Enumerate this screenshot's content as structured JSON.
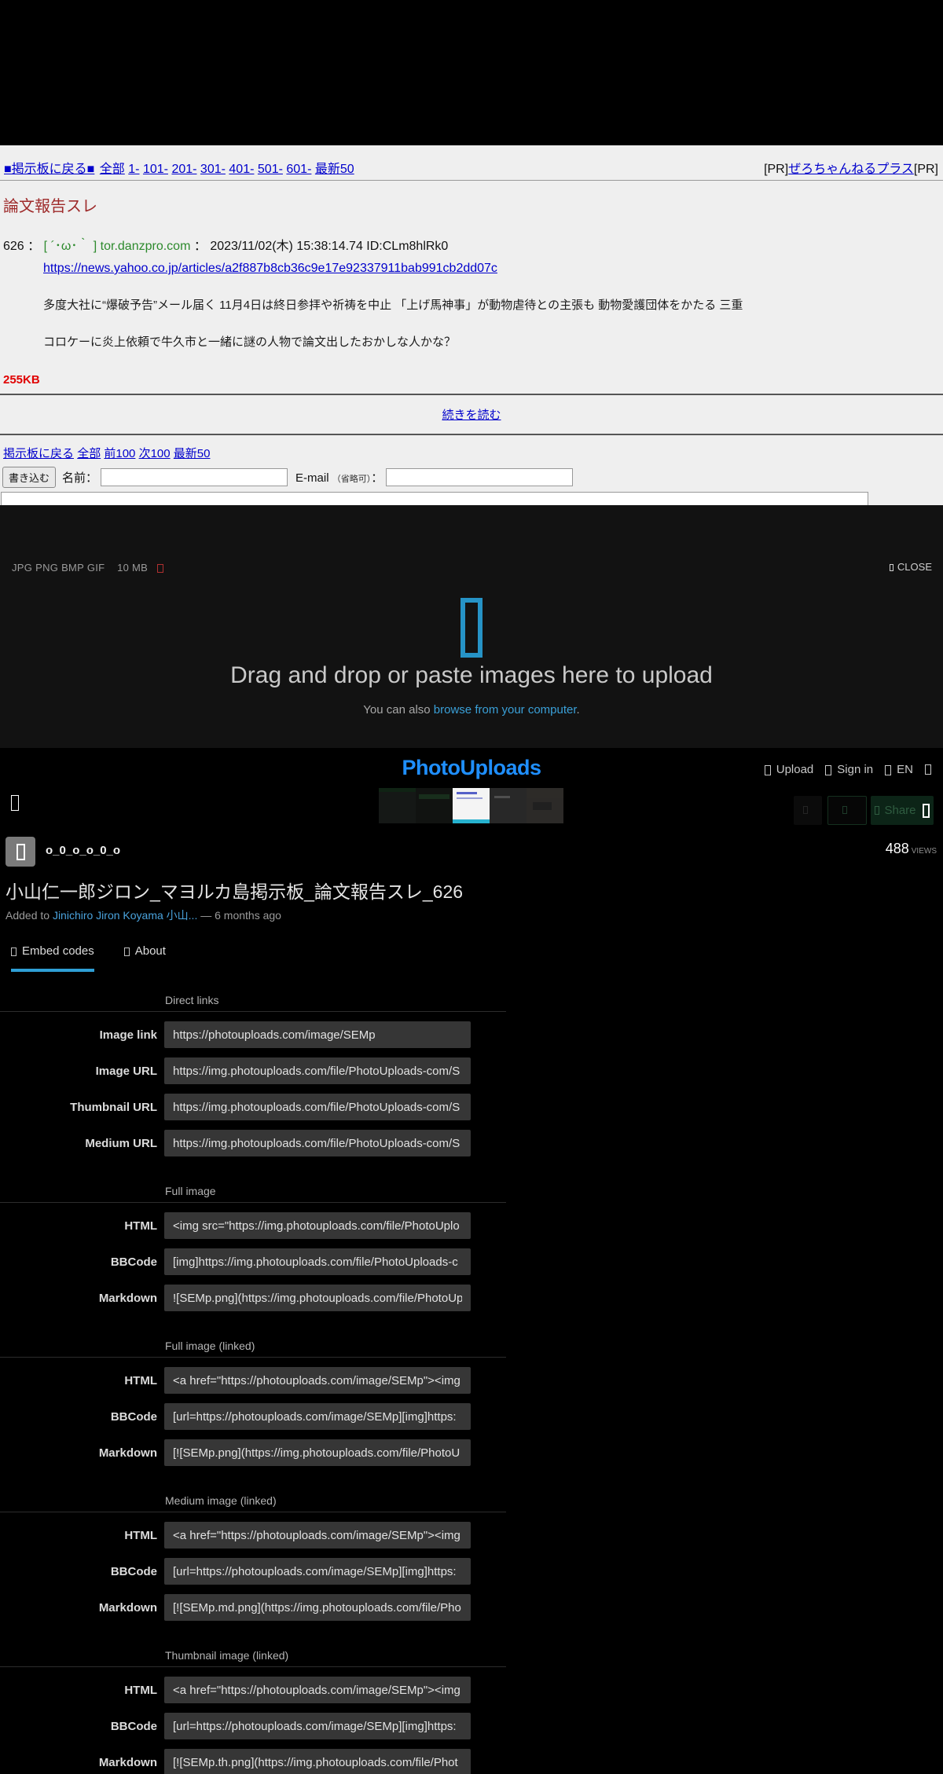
{
  "board": {
    "nav_top": {
      "back": "■掲示板に戻る■",
      "links": [
        "全部",
        "1-",
        "101-",
        "201-",
        "301-",
        "401-",
        "501-",
        "601-",
        "最新50"
      ],
      "pr_left": "[PR]",
      "pr_link": "ぜろちゃんねるプラス",
      "pr_right": "[PR]"
    },
    "thread_title": "論文報告スレ",
    "post": {
      "number": "626",
      "sep1": "：",
      "name": "[ ´･ω･｀ ] tor.danzpro.com",
      "sep2": "：",
      "datetime": "2023/11/02(木) 15:38:14.74 ID:CLm8hlRk0",
      "link": "https://news.yahoo.co.jp/articles/a2f887b8cb36c9e17e92337911bab991cb2dd07c",
      "body1": "多度大社に“爆破予告”メール届く 11月4日は終日参拝や祈祷を中止 「上げ馬神事」が動物虐待との主張も 動物愛護団体をかたる 三重",
      "body2": "コロケーに炎上依頼で牛久市と一緒に謎の人物で論文出したおかしな人かな？"
    },
    "size_label": "255KB",
    "read_more": "続きを読む",
    "nav_bottom": [
      "掲示板に戻る",
      "全部",
      "前100",
      "次100",
      "最新50"
    ],
    "form": {
      "submit": "書き込む",
      "name_label": "名前：",
      "email_label": "E-mail",
      "email_note": "（省略可）",
      "email_colon": "："
    }
  },
  "overlay": {
    "formats": "JPG PNG BMP GIF",
    "max_size": "10 MB",
    "close": "CLOSE",
    "heading": "Drag and drop or paste images here to upload",
    "sub_prefix": "You can also ",
    "sub_link": "browse from your computer",
    "sub_suffix": "."
  },
  "site": {
    "logo": "PhotoUploads",
    "nav": {
      "upload": "Upload",
      "signin": "Sign in",
      "lang": "EN"
    },
    "share_label": "Share",
    "user": {
      "name": "o_0_o_o_0_o",
      "views_count": "488",
      "views_label": "VIEWS"
    },
    "image_title": "小山仁一郎ジロン_マヨルカ島掲示板_論文報告スレ_626",
    "meta": {
      "prefix": "Added to ",
      "album": "Jinichiro Jiron Koyama 小山...",
      "suffix": " — 6 months ago"
    },
    "tabs": {
      "embed": "Embed codes",
      "about": "About"
    },
    "colors": {
      "accent": "#2f9fd6",
      "logo": "#1f8fff",
      "upload_icon": "#2693c6"
    }
  },
  "embed": {
    "sections": [
      {
        "title": "Direct links",
        "rows": [
          {
            "label": "Image link",
            "value": "https://photouploads.com/image/SEMp"
          },
          {
            "label": "Image URL",
            "value": "https://img.photouploads.com/file/PhotoUploads-com/S"
          },
          {
            "label": "Thumbnail URL",
            "value": "https://img.photouploads.com/file/PhotoUploads-com/S"
          },
          {
            "label": "Medium URL",
            "value": "https://img.photouploads.com/file/PhotoUploads-com/S"
          }
        ]
      },
      {
        "title": "Full image",
        "rows": [
          {
            "label": "HTML",
            "value": "<img src=\"https://img.photouploads.com/file/PhotoUplo"
          },
          {
            "label": "BBCode",
            "value": "[img]https://img.photouploads.com/file/PhotoUploads-c"
          },
          {
            "label": "Markdown",
            "value": "![SEMp.png](https://img.photouploads.com/file/PhotoUp"
          }
        ]
      },
      {
        "title": "Full image (linked)",
        "rows": [
          {
            "label": "HTML",
            "value": "<a href=\"https://photouploads.com/image/SEMp\"><img"
          },
          {
            "label": "BBCode",
            "value": "[url=https://photouploads.com/image/SEMp][img]https:"
          },
          {
            "label": "Markdown",
            "value": "[![SEMp.png](https://img.photouploads.com/file/PhotoU"
          }
        ]
      },
      {
        "title": "Medium image (linked)",
        "rows": [
          {
            "label": "HTML",
            "value": "<a href=\"https://photouploads.com/image/SEMp\"><img"
          },
          {
            "label": "BBCode",
            "value": "[url=https://photouploads.com/image/SEMp][img]https:"
          },
          {
            "label": "Markdown",
            "value": "[![SEMp.md.png](https://img.photouploads.com/file/Pho"
          }
        ]
      },
      {
        "title": "Thumbnail image (linked)",
        "rows": [
          {
            "label": "HTML",
            "value": "<a href=\"https://photouploads.com/image/SEMp\"><img"
          },
          {
            "label": "BBCode",
            "value": "[url=https://photouploads.com/image/SEMp][img]https:"
          },
          {
            "label": "Markdown",
            "value": "[![SEMp.th.png](https://img.photouploads.com/file/Phot"
          }
        ]
      }
    ]
  }
}
